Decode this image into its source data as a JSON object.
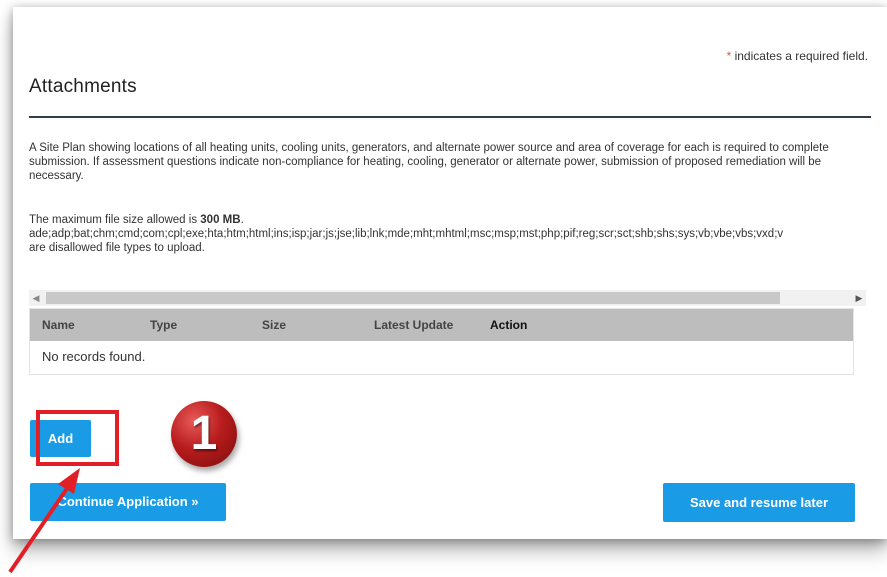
{
  "required_note": {
    "star": "*",
    "text": " indicates a required field."
  },
  "section": {
    "title": "Attachments",
    "description": "A Site Plan showing locations of all heating units, cooling units, generators, and alternate power source and area of coverage for each is required to complete submission. If assessment questions indicate non-compliance for heating, cooling, generator or alternate power, submission of proposed remediation will be necessary.",
    "max_size_prefix": "The maximum file size allowed is ",
    "max_size_value": "300 MB",
    "max_size_suffix": ".",
    "disallowed_types": "ade;adp;bat;chm;cmd;com;cpl;exe;hta;htm;html;ins;isp;jar;js;jse;lib;lnk;mde;mht;mhtml;msc;msp;mst;php;pif;reg;scr;sct;shb;shs;sys;vb;vbe;vbs;vxd;v",
    "disallowed_suffix": "are disallowed file types to upload."
  },
  "table": {
    "columns": [
      "Name",
      "Type",
      "Size",
      "Latest Update",
      "Action"
    ],
    "empty_message": "No records found."
  },
  "buttons": {
    "add": "Add",
    "continue": "Continue Application »",
    "save": "Save and resume later"
  },
  "annotation": {
    "step_number": "1",
    "highlight_color": "#e21f26",
    "badge_color": "#b81c1c"
  },
  "accent_color": "#1a9be6"
}
